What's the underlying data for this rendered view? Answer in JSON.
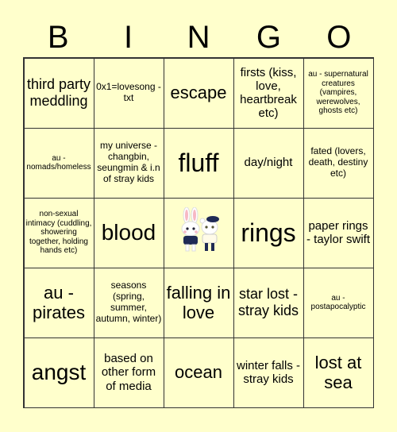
{
  "header": {
    "letters": [
      "B",
      "I",
      "N",
      "G",
      "O"
    ]
  },
  "cells": [
    {
      "text": "third party meddling",
      "size": "s-lg"
    },
    {
      "text": "0x1=lovesong - txt",
      "size": "s-sm"
    },
    {
      "text": "escape",
      "size": "s-xl"
    },
    {
      "text": "firsts (kiss, love, heartbreak etc)",
      "size": "s-md"
    },
    {
      "text": "au - supernatural creatures (vampires, werewolves, ghosts etc)",
      "size": "s-xs"
    },
    {
      "text": "au - nomads/homeless",
      "size": "s-xs"
    },
    {
      "text": "my universe - changbin, seungmin & i.n of stray kids",
      "size": "s-sm"
    },
    {
      "text": "fluff",
      "size": "s-xxxl"
    },
    {
      "text": "day/night",
      "size": "s-md"
    },
    {
      "text": "fated (lovers, death, destiny etc)",
      "size": "s-sm"
    },
    {
      "text": "non-sexual intimacy (cuddling, showering together, holding hands etc)",
      "size": "s-xs"
    },
    {
      "text": "blood",
      "size": "s-xxl"
    },
    {
      "text": "",
      "free": true,
      "icon": "bunny-and-bear-mascots-icon"
    },
    {
      "text": "rings",
      "size": "s-xxxl"
    },
    {
      "text": "paper rings - taylor swift",
      "size": "s-md"
    },
    {
      "text": "au - pirates",
      "size": "s-xl"
    },
    {
      "text": "seasons (spring, summer, autumn, winter)",
      "size": "s-sm"
    },
    {
      "text": "falling in love",
      "size": "s-xl"
    },
    {
      "text": "star lost - stray kids",
      "size": "s-lg"
    },
    {
      "text": "au - postapocalyptic",
      "size": "s-xs"
    },
    {
      "text": "angst",
      "size": "s-xxl"
    },
    {
      "text": "based on other form of media",
      "size": "s-md"
    },
    {
      "text": "ocean",
      "size": "s-xl"
    },
    {
      "text": "winter falls - stray kids",
      "size": "s-md"
    },
    {
      "text": "lost at sea",
      "size": "s-xl"
    }
  ],
  "colors": {
    "background": "#ffffcc",
    "border": "#333333"
  }
}
